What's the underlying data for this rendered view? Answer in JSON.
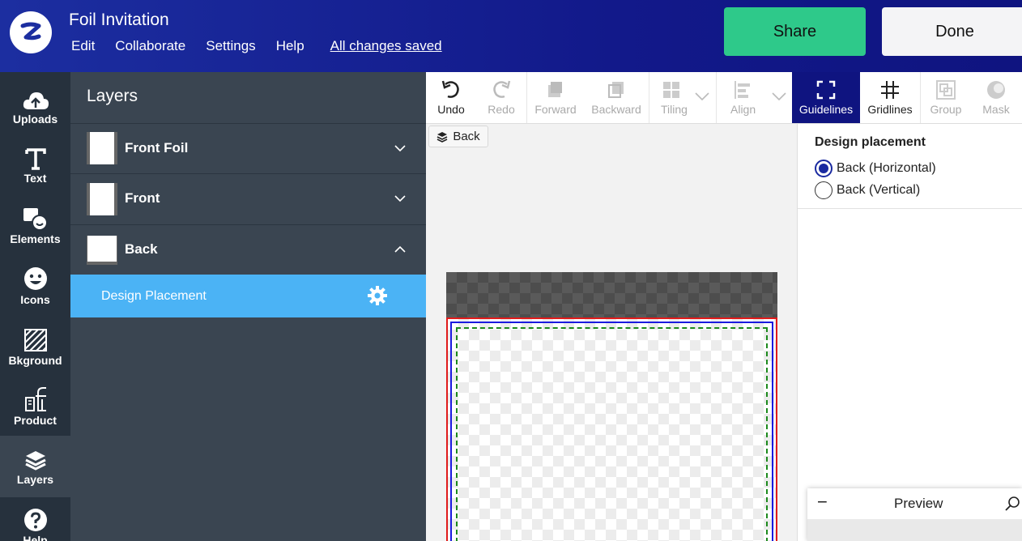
{
  "header": {
    "doc_title": "Foil Invitation",
    "menu": [
      "Edit",
      "Collaborate",
      "Settings",
      "Help"
    ],
    "saved_status": "All changes saved",
    "share_label": "Share",
    "done_label": "Done"
  },
  "rail": {
    "items": [
      {
        "label": "Uploads",
        "icon": "cloud-upload-icon"
      },
      {
        "label": "Text",
        "icon": "text-icon"
      },
      {
        "label": "Elements",
        "icon": "elements-icon"
      },
      {
        "label": "Icons",
        "icon": "smiley-icon"
      },
      {
        "label": "Bkground",
        "icon": "background-icon"
      },
      {
        "label": "Product",
        "icon": "product-icon"
      },
      {
        "label": "Layers",
        "icon": "layers-icon"
      },
      {
        "label": "Help",
        "icon": "help-icon"
      }
    ],
    "active": "Layers"
  },
  "layers_panel": {
    "title": "Layers",
    "layers": [
      {
        "name": "Front Foil",
        "expanded": false
      },
      {
        "name": "Front",
        "expanded": false
      },
      {
        "name": "Back",
        "expanded": true
      }
    ],
    "sub_item": "Design Placement"
  },
  "toolbar": {
    "tools": [
      {
        "label": "Undo",
        "enabled": true
      },
      {
        "label": "Redo",
        "enabled": false
      },
      {
        "label": "Forward",
        "enabled": false
      },
      {
        "label": "Backward",
        "enabled": false
      },
      {
        "label": "Tiling",
        "enabled": false
      },
      {
        "label": "Align",
        "enabled": false
      },
      {
        "label": "Guidelines",
        "enabled": true,
        "active": true
      },
      {
        "label": "Gridlines",
        "enabled": true
      },
      {
        "label": "Group",
        "enabled": false
      },
      {
        "label": "Mask",
        "enabled": false
      }
    ]
  },
  "canvas": {
    "back_button": "Back"
  },
  "right_panel": {
    "title": "Design placement",
    "options": [
      "Back (Horizontal)",
      "Back (Vertical)"
    ],
    "selected": "Back (Horizontal)"
  },
  "preview": {
    "title": "Preview",
    "minimize": "−"
  },
  "colors": {
    "header": "#12198a",
    "share": "#2ec98a",
    "rail": "#26313d",
    "panel": "#3a4551",
    "selected_row": "#4bb3f5",
    "active_tool": "#0f1480"
  }
}
